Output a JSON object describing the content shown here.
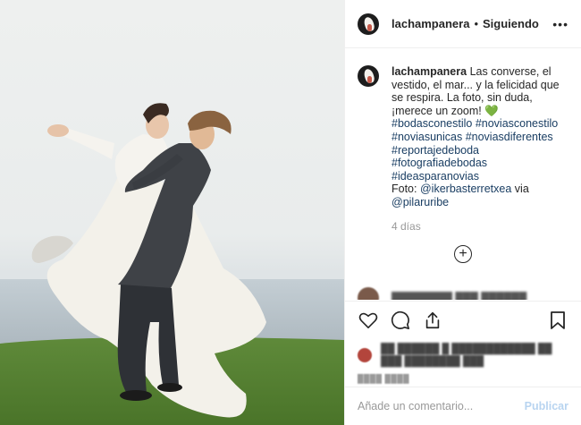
{
  "post": {
    "username": "lachampanera",
    "separator": "•",
    "follow_status": "Siguiendo",
    "more_label": "•••"
  },
  "caption": {
    "username": "lachampanera",
    "text": "Las converse, el vestido, el mar... y la felicidad que se respira. La foto, sin duda, ¡merece un zoom! 💚",
    "hashtags": [
      "#bodasconestilo #noviasconestilo",
      "#noviasunicas #noviasdiferentes",
      "#reportajedeboda",
      "#fotografiadebodas",
      "#ideasparanovias"
    ],
    "credit_prefix": "Foto:",
    "credit_user": "@ikerbasterretxea",
    "credit_via": "via",
    "credit_user2": "@pilaruribe",
    "age": "4 días"
  },
  "load_more_label": "+",
  "icons": {
    "like": "heart-icon",
    "comment": "comment-icon",
    "share": "share-icon",
    "save": "bookmark-icon"
  },
  "composer": {
    "placeholder": "Añade un comentario...",
    "publish_label": "Publicar"
  },
  "colors": {
    "link": "#1a3e63",
    "publish_disabled": "#b8d4f0",
    "meta_gray": "#999999",
    "border": "#efefef"
  }
}
